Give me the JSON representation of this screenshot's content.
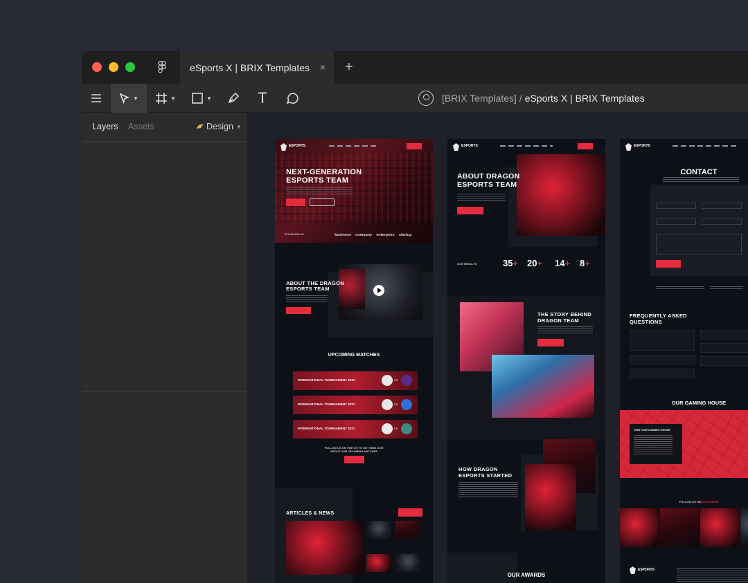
{
  "window": {
    "tab_title": "eSports X | BRIX Templates",
    "tab_close": "×",
    "tab_add": "+",
    "breadcrumb_team": "[BRIX Templates] /",
    "breadcrumb_file": "eSports X | BRIX Templates"
  },
  "toolbar": {
    "menu_icon": "hamburger-icon",
    "tools": [
      "move-tool-icon",
      "frame-tool-icon",
      "shape-tool-icon",
      "pen-tool-icon",
      "text-tool-icon",
      "comment-tool-icon"
    ],
    "active_tool": "move-tool-icon",
    "text_tool_glyph": "T"
  },
  "panel": {
    "tab_layers": "Layers",
    "tab_assets": "Assets",
    "tab_design": "Design"
  },
  "colors": {
    "accent": "#e52b3e",
    "window_bg": "#2c2c2c",
    "canvas_bg": "#1e2129",
    "artboard_bg": "#0e1018"
  },
  "artboard1": {
    "brand": "ESPORTS",
    "hero_title_1": "NEXT-GENERATION",
    "hero_title_2": "ESPORTS TEAM",
    "partners_label": "SPONSORED BY",
    "partners": [
      "business",
      "company",
      "enterprise",
      "startup"
    ],
    "about_title_1": "ABOUT THE DRAGON",
    "about_title_2": "ESPORTS TEAM",
    "matches_title": "UPCOMING MATCHES",
    "matches": [
      {
        "title": "INTERNATIONAL TOURNAMENT 2021",
        "vs": "VS"
      },
      {
        "title": "INTERNATIONAL TOURNAMENT 2021",
        "vs": "VS"
      },
      {
        "title": "INTERNATIONAL TOURNAMENT 2021",
        "vs": "VS"
      }
    ],
    "follow_line_1": "FOLLOW US ON TWITCH TO NOT MISS OUR",
    "follow_line_2": "ABOUT OUR UPCOMING MATCHES",
    "articles_title": "ARTICLES & NEWS"
  },
  "artboard2": {
    "brand": "ESPORTS",
    "about_title_1": "ABOUT DRAGON",
    "about_title_2": "ESPORTS TEAM",
    "results_label": "OUR RESULTS",
    "stats": [
      {
        "value": "35",
        "plus": "+"
      },
      {
        "value": "20",
        "plus": "+"
      },
      {
        "value": "14",
        "plus": "+"
      },
      {
        "value": "8",
        "plus": "+"
      }
    ],
    "story_title_1": "THE STORY BEHIND",
    "story_title_2": "DRAGON TEAM",
    "started_title_1": "HOW DRAGON",
    "started_title_2": "ESPORTS STARTED",
    "awards_title": "OUR AWARDS"
  },
  "artboard3": {
    "brand": "ESPORTS",
    "contact_title": "CONTACT",
    "faq_title_1": "FREQUENTLY ASKED",
    "faq_title_2": "QUESTIONS",
    "gaming_house_title": "OUR GAMING HOUSE",
    "map_card_title": "VISIT OUR GAMING HOUSE",
    "instagram_1": "FOLLOW US ON",
    "instagram_2": "INSTAGRAM",
    "footer_brand": "ESPORTS"
  }
}
